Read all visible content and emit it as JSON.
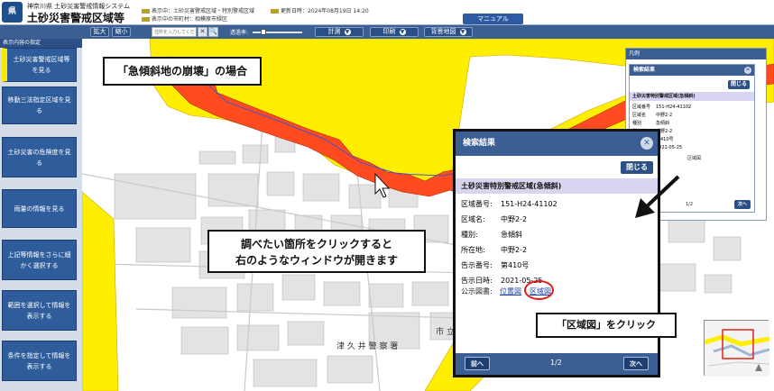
{
  "header": {
    "subtitle": "神奈川県 土砂災害警戒情報システム",
    "title": "土砂災害警戒区域等",
    "display_info": "表示中：土砂災害警戒区域・特別警戒区域",
    "municipality_info": "表示中の市町村：相模原市緑区",
    "updated": "更新日時：2024年08月19日 14:20",
    "manual_label": "マニュアル"
  },
  "toolbar": {
    "zoom_in": "拡大",
    "zoom_out": "縮小",
    "search_placeholder": "住所を入力してくださ",
    "clear_symbol": "✕",
    "search_symbol": "🔍",
    "transparency_label": "透過率:",
    "transparency_value": 0.22,
    "measure_label": "計測",
    "print_label": "印刷",
    "basemap_label": "背景地図"
  },
  "sidebar": {
    "heading": "表示内容の指定",
    "items": [
      {
        "label": "土砂災害警戒区域等を見る"
      },
      {
        "label": "移動三法指定区域を見る"
      },
      {
        "label": "土砂災害の危険度を見る"
      },
      {
        "label": "雨量の情報を見る"
      },
      {
        "label": "上記等情報をさらに細かく選択する"
      },
      {
        "label": "範囲を選択して情報を表示する"
      },
      {
        "label": "条件を指定して情報を表示する"
      }
    ]
  },
  "map": {
    "label_police": "津 久 井 警 察 署",
    "label_city": "市 立",
    "colors": {
      "special_zone": "#ff4b1f",
      "warning_zone": "#ffee00",
      "buildings": "#e3e3e3"
    }
  },
  "callouts": {
    "top_left": "「急傾斜地の崩壊」の場合",
    "center_line1": "調べたい箇所をクリックすると",
    "center_line2": "右のようなウィンドウが開きます",
    "bottom": "「区域図」をクリック"
  },
  "legend": {
    "title": "凡例"
  },
  "small_dialog": {
    "title": "検索結果",
    "close_label": "閉じる",
    "band": "土砂災害特別警戒区域(急傾斜)",
    "rows": [
      {
        "k": "区域番号",
        "v": "151-H24-41102"
      },
      {
        "k": "区域名",
        "v": "中野2-2"
      },
      {
        "k": "種別",
        "v": "急傾斜"
      },
      {
        "k": "所在地",
        "v": "中野2-2"
      },
      {
        "k": "告示番号",
        "v": "第410号"
      },
      {
        "k": "告示日時",
        "v": "2021-05-25"
      }
    ],
    "map_link": "区域図",
    "page": "1/2",
    "next_label": "次へ"
  },
  "dialog": {
    "title": "検索結果",
    "close_label": "閉じる",
    "band": "土砂災害特別警戒区域(急傾斜)",
    "rows": [
      {
        "k": "区域番号:",
        "v": "151-H24-41102"
      },
      {
        "k": "区域名:",
        "v": "中野2-2"
      },
      {
        "k": "種別:",
        "v": "急傾斜"
      },
      {
        "k": "所在地:",
        "v": "中野2-2"
      },
      {
        "k": "告示番号:",
        "v": "第410号"
      },
      {
        "k": "告示日時:",
        "v": "2021-05-25"
      }
    ],
    "docs_label": "公示図書:",
    "link_position": "位置図",
    "link_area": "区域図",
    "prev_label": "前へ",
    "page": "1/2",
    "next_label": "次へ"
  }
}
